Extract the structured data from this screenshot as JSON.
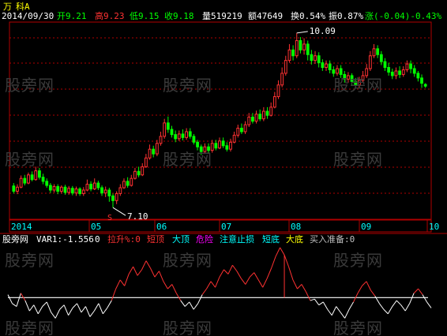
{
  "colors": {
    "up": "#ff3232",
    "down": "#00ff00",
    "frame": "#b00000",
    "white": "#ffffff",
    "yellow": "#ffff00",
    "cyan": "#00ffff",
    "magenta": "#ff00ff",
    "gray": "#c0c0c0"
  },
  "header": {
    "symbol": "万",
    "name": "科A",
    "date": "2014/09/30",
    "open": "开9.21",
    "high": "高9.23",
    "low": "低9.15",
    "close": "收9.18",
    "volume": "量519219",
    "amount": "额47649",
    "turnover": "换0.54%",
    "amplitude": "振0.87%",
    "change": "涨(-0.04)-0.43%"
  },
  "indicator_header": {
    "name": "股旁网",
    "var1": "VAR1:-1.556",
    "var1_val": "0",
    "rise": "拉升%:0",
    "shortTop": "短顶",
    "bigTop": "大顶",
    "danger": "危险",
    "stopLoss": "注意止损",
    "shortBottom": "短底",
    "bigBottom": "大底",
    "buyPrep": "买入准备:0"
  },
  "watermark": "股旁网",
  "chart_data": {
    "type": "candlestick",
    "x_tick_labels": [
      "2014",
      "05",
      "06",
      "07",
      "08",
      "09",
      "10"
    ],
    "annotations": {
      "high_label": "10.09",
      "low_label": "7.10",
      "marker": "S"
    },
    "ylim": [
      6.9,
      10.25
    ],
    "candles": [
      [
        7.47,
        7.38,
        7.52,
        7.34
      ],
      [
        7.38,
        7.45,
        7.5,
        7.33
      ],
      [
        7.45,
        7.6,
        7.65,
        7.43
      ],
      [
        7.6,
        7.52,
        7.66,
        7.48
      ],
      [
        7.52,
        7.66,
        7.7,
        7.5
      ],
      [
        7.66,
        7.58,
        7.72,
        7.55
      ],
      [
        7.58,
        7.73,
        7.8,
        7.56
      ],
      [
        7.73,
        7.62,
        7.78,
        7.58
      ],
      [
        7.62,
        7.55,
        7.68,
        7.5
      ],
      [
        7.55,
        7.48,
        7.6,
        7.44
      ],
      [
        7.48,
        7.4,
        7.52,
        7.35
      ],
      [
        7.4,
        7.46,
        7.5,
        7.36
      ],
      [
        7.46,
        7.38,
        7.5,
        7.33
      ],
      [
        7.38,
        7.45,
        7.48,
        7.34
      ],
      [
        7.45,
        7.36,
        7.49,
        7.32
      ],
      [
        7.36,
        7.43,
        7.47,
        7.32
      ],
      [
        7.43,
        7.35,
        7.47,
        7.31
      ],
      [
        7.35,
        7.42,
        7.46,
        7.3
      ],
      [
        7.42,
        7.34,
        7.45,
        7.3
      ],
      [
        7.34,
        7.4,
        7.45,
        7.3
      ],
      [
        7.4,
        7.5,
        7.58,
        7.38
      ],
      [
        7.5,
        7.42,
        7.55,
        7.38
      ],
      [
        7.42,
        7.52,
        7.6,
        7.4
      ],
      [
        7.52,
        7.44,
        7.56,
        7.4
      ],
      [
        7.44,
        7.35,
        7.48,
        7.3
      ],
      [
        7.35,
        7.4,
        7.46,
        7.28
      ],
      [
        7.4,
        7.3,
        7.44,
        7.2
      ],
      [
        7.3,
        7.22,
        7.34,
        7.1
      ],
      [
        7.22,
        7.34,
        7.38,
        7.16
      ],
      [
        7.34,
        7.44,
        7.5,
        7.3
      ],
      [
        7.44,
        7.55,
        7.6,
        7.42
      ],
      [
        7.55,
        7.48,
        7.62,
        7.44
      ],
      [
        7.48,
        7.6,
        7.66,
        7.46
      ],
      [
        7.6,
        7.72,
        7.78,
        7.58
      ],
      [
        7.72,
        7.66,
        7.8,
        7.62
      ],
      [
        7.66,
        7.8,
        7.86,
        7.64
      ],
      [
        7.8,
        7.95,
        8.02,
        7.78
      ],
      [
        7.95,
        8.1,
        8.18,
        7.92
      ],
      [
        8.1,
        8.02,
        8.16,
        7.96
      ],
      [
        8.02,
        8.2,
        8.26,
        7.98
      ],
      [
        8.2,
        8.32,
        8.4,
        8.16
      ],
      [
        8.32,
        8.55,
        8.62,
        8.28
      ],
      [
        8.55,
        8.44,
        8.66,
        8.38
      ],
      [
        8.44,
        8.35,
        8.5,
        8.3
      ],
      [
        8.35,
        8.28,
        8.42,
        8.22
      ],
      [
        8.28,
        8.36,
        8.42,
        8.24
      ],
      [
        8.36,
        8.3,
        8.44,
        8.25
      ],
      [
        8.3,
        8.4,
        8.46,
        8.26
      ],
      [
        8.4,
        8.32,
        8.46,
        8.28
      ],
      [
        8.32,
        8.22,
        8.36,
        8.18
      ],
      [
        8.22,
        8.14,
        8.26,
        8.08
      ],
      [
        8.14,
        8.06,
        8.18,
        8.0
      ],
      [
        8.06,
        8.14,
        8.2,
        8.02
      ],
      [
        8.14,
        8.08,
        8.2,
        8.04
      ],
      [
        8.08,
        8.2,
        8.26,
        8.04
      ],
      [
        8.2,
        8.12,
        8.26,
        8.08
      ],
      [
        8.12,
        8.24,
        8.3,
        8.1
      ],
      [
        8.24,
        8.16,
        8.3,
        8.12
      ],
      [
        8.16,
        8.1,
        8.22,
        8.06
      ],
      [
        8.1,
        8.22,
        8.28,
        8.06
      ],
      [
        8.22,
        8.34,
        8.4,
        8.2
      ],
      [
        8.34,
        8.46,
        8.52,
        8.3
      ],
      [
        8.46,
        8.4,
        8.54,
        8.36
      ],
      [
        8.4,
        8.52,
        8.58,
        8.36
      ],
      [
        8.52,
        8.65,
        8.72,
        8.48
      ],
      [
        8.65,
        8.58,
        8.72,
        8.54
      ],
      [
        8.58,
        8.7,
        8.76,
        8.54
      ],
      [
        8.7,
        8.62,
        8.78,
        8.58
      ],
      [
        8.62,
        8.75,
        8.82,
        8.58
      ],
      [
        8.75,
        8.68,
        8.82,
        8.62
      ],
      [
        8.68,
        8.82,
        8.9,
        8.66
      ],
      [
        8.82,
        9.0,
        9.08,
        8.8
      ],
      [
        9.0,
        9.2,
        9.28,
        8.96
      ],
      [
        9.2,
        9.4,
        9.5,
        9.16
      ],
      [
        9.4,
        9.62,
        9.7,
        9.36
      ],
      [
        9.62,
        9.8,
        9.9,
        9.58
      ],
      [
        9.8,
        9.7,
        9.88,
        9.62
      ],
      [
        9.7,
        9.96,
        10.09,
        9.66
      ],
      [
        9.96,
        9.8,
        10.02,
        9.74
      ],
      [
        9.8,
        9.9,
        10.0,
        9.72
      ],
      [
        9.9,
        9.72,
        9.96,
        9.62
      ],
      [
        9.72,
        9.62,
        9.8,
        9.55
      ],
      [
        9.62,
        9.7,
        9.78,
        9.56
      ],
      [
        9.7,
        9.58,
        9.76,
        9.5
      ],
      [
        9.58,
        9.5,
        9.64,
        9.44
      ],
      [
        9.5,
        9.56,
        9.62,
        9.44
      ],
      [
        9.56,
        9.46,
        9.62,
        9.4
      ],
      [
        9.46,
        9.4,
        9.52,
        9.34
      ],
      [
        9.4,
        9.48,
        9.54,
        9.36
      ],
      [
        9.48,
        9.38,
        9.54,
        9.32
      ],
      [
        9.38,
        9.3,
        9.44,
        9.24
      ],
      [
        9.3,
        9.36,
        9.42,
        9.24
      ],
      [
        9.36,
        9.26,
        9.4,
        9.2
      ],
      [
        9.26,
        9.2,
        9.32,
        9.14
      ],
      [
        9.2,
        9.28,
        9.34,
        9.14
      ],
      [
        9.28,
        9.36,
        9.44,
        9.24
      ],
      [
        9.36,
        9.48,
        9.56,
        9.32
      ],
      [
        9.48,
        9.7,
        9.78,
        9.44
      ],
      [
        9.7,
        9.82,
        9.9,
        9.66
      ],
      [
        9.82,
        9.72,
        9.88,
        9.66
      ],
      [
        9.72,
        9.6,
        9.78,
        9.54
      ],
      [
        9.6,
        9.5,
        9.66,
        9.44
      ],
      [
        9.5,
        9.42,
        9.58,
        9.36
      ],
      [
        9.42,
        9.36,
        9.48,
        9.3
      ],
      [
        9.36,
        9.44,
        9.5,
        9.3
      ],
      [
        9.44,
        9.38,
        9.52,
        9.32
      ],
      [
        9.38,
        9.46,
        9.52,
        9.34
      ],
      [
        9.46,
        9.56,
        9.62,
        9.42
      ],
      [
        9.56,
        9.48,
        9.62,
        9.4
      ],
      [
        9.48,
        9.4,
        9.54,
        9.34
      ],
      [
        9.4,
        9.32,
        9.44,
        9.26
      ],
      [
        9.32,
        9.23,
        9.38,
        9.15
      ],
      [
        9.21,
        9.18,
        9.23,
        9.15
      ]
    ],
    "indicator": {
      "ylim": [
        -2.5,
        3.5
      ],
      "baseline": 0,
      "values": [
        0.2,
        -0.4,
        -0.6,
        0.3,
        -0.2,
        -0.9,
        -0.5,
        -1.1,
        -0.6,
        -0.3,
        -1.0,
        -1.4,
        -0.8,
        -0.5,
        -1.2,
        -0.7,
        -0.4,
        -1.0,
        -0.6,
        -1.3,
        -0.9,
        -0.4,
        -1.1,
        -0.7,
        -0.2,
        0.6,
        1.2,
        0.8,
        1.6,
        2.1,
        1.5,
        1.9,
        2.5,
        2.0,
        1.4,
        1.8,
        1.1,
        0.6,
        0.9,
        0.3,
        -0.2,
        -0.6,
        -0.3,
        -0.8,
        -0.4,
        0.2,
        0.6,
        1.1,
        0.7,
        1.4,
        1.9,
        1.6,
        2.2,
        1.8,
        1.3,
        0.9,
        1.4,
        1.7,
        1.2,
        0.7,
        1.3,
        2.0,
        2.8,
        3.4,
        2.9,
        2.1,
        1.2,
        0.6,
        0.9,
        0.4,
        -0.2,
        -0.1,
        -0.5,
        -0.3,
        -0.8,
        -1.2,
        -0.6,
        -1.0,
        -1.4,
        -0.8,
        -0.3,
        0.3,
        0.8,
        1.1,
        0.5,
        0.1,
        -0.4,
        -0.8,
        -1.1,
        -0.6,
        -0.2,
        -0.5,
        -0.9,
        -0.4,
        0.3,
        0.6,
        0.2,
        -0.3,
        -0.7
      ],
      "signal_index": 64
    }
  }
}
